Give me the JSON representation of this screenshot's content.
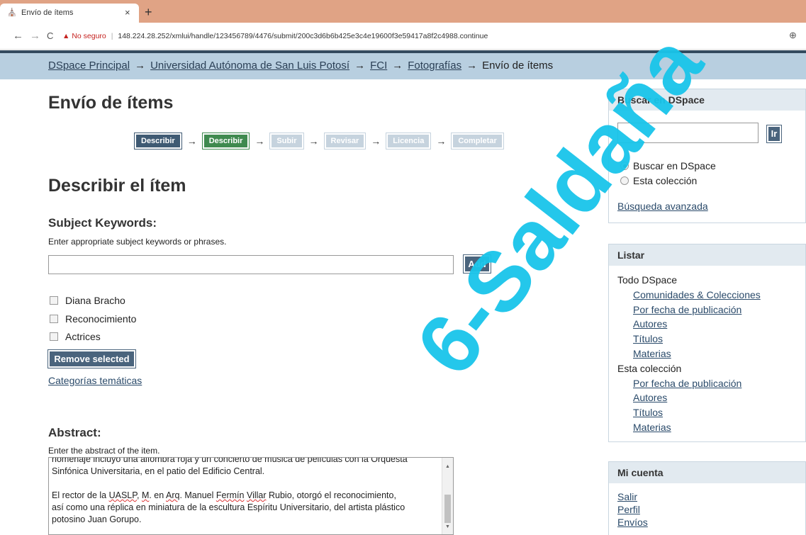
{
  "browser": {
    "tab_title": "Envío de ítems",
    "tab_close": "×",
    "new_tab": "+",
    "back": "←",
    "forward": "→",
    "reload": "C",
    "not_secure": "No seguro",
    "url": "148.224.28.252/xmlui/handle/123456789/4476/submit/200c3d6b6b425e3c4e19600f3e59417a8f2c4988.continue"
  },
  "breadcrumb": {
    "items": [
      "DSpace Principal",
      "Universidad Autónoma de San Luis Potosí",
      "FCI",
      "Fotografías"
    ],
    "current": "Envío de ítems",
    "arrow": "→"
  },
  "main": {
    "title": "Envío de ítems",
    "steps": [
      "Describir",
      "Describir",
      "Subir",
      "Revisar",
      "Licencia",
      "Completar"
    ],
    "step_arrow": "→",
    "section_title": "Describir el ítem",
    "keywords": {
      "label": "Subject Keywords:",
      "help": "Enter appropriate subject keywords or phrases.",
      "value": "",
      "add_label": "Add",
      "items": [
        "Diana Bracho",
        "Reconocimiento",
        "Actrices"
      ],
      "remove_label": "Remove selected",
      "categories_link": "Categorías temáticas"
    },
    "abstract": {
      "label": "Abstract:",
      "help": "Enter the abstract of the item.",
      "line0": "homenaje incluyó una alfombra roja y un concierto de música de películas con la Orquesta",
      "line1": "Sinfónica Universitaria, en el patio del Edificio Central.",
      "p2_a": "El rector de la ",
      "p2_uaslp": "UASLP",
      "p2_b": ", ",
      "p2_m": "M",
      "p2_c": ". en ",
      "p2_arq": "Arq",
      "p2_d": ". Manuel ",
      "p2_fermin": "Fermín",
      "p2_e": " ",
      "p2_villar": "Villar",
      "p2_f": " Rubio, otorgó el reconocimiento,",
      "p2_line2": "así como una réplica en miniatura de la escultura Espíritu Universitario, del artista plástico",
      "p2_line3a": "potosino Juan ",
      "p2_gorupo": "Gorupo",
      "p2_line3b": "."
    }
  },
  "sidebar": {
    "search": {
      "title": "Buscar en DSpace",
      "go_label": "Ir",
      "value": "",
      "options": [
        "Buscar en DSpace",
        "Esta colección"
      ],
      "advanced": "Búsqueda avanzada"
    },
    "browse": {
      "title": "Listar",
      "all_header": "Todo DSpace",
      "all_items": [
        "Comunidades & Colecciones",
        "Por fecha de publicación",
        "Autores",
        "Títulos",
        "Materias"
      ],
      "coll_header": "Esta colección",
      "coll_items": [
        "Por fecha de publicación",
        "Autores",
        "Títulos",
        "Materias"
      ]
    },
    "account": {
      "title": "Mi cuenta",
      "items": [
        "Salir",
        "Perfil",
        "Envíos"
      ]
    }
  },
  "watermark": "6-Saldaña",
  "colors": {
    "tab_strip": "#e0a385",
    "trail_bg": "#b8cfe0",
    "step_done": "#3f5a73",
    "step_current": "#3f8a4f",
    "step_todo": "#c6d3de",
    "watermark": "#19c5ea"
  }
}
